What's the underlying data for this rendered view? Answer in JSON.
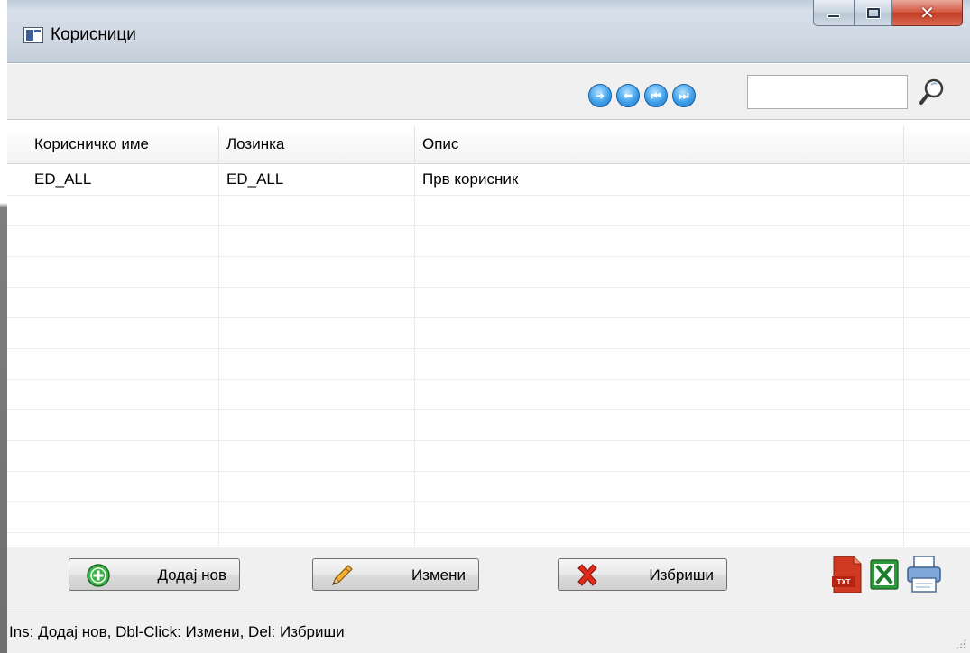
{
  "window": {
    "title": "Корисници"
  },
  "toolbar": {
    "nav_buttons": [
      {
        "icon": "arrow-right-icon",
        "glyph": "➜"
      },
      {
        "icon": "arrow-left-icon",
        "glyph": "⬅"
      },
      {
        "icon": "first-icon",
        "glyph": "⏮"
      },
      {
        "icon": "last-icon",
        "glyph": "⏭"
      }
    ],
    "search_value": ""
  },
  "grid": {
    "columns": [
      "Корисничко име",
      "Лозинка",
      "Опис"
    ],
    "rows": [
      [
        "ED_ALL",
        "ED_ALL",
        "Прв корисник"
      ]
    ]
  },
  "actions": {
    "add_label": "Додај нов",
    "edit_label": "Измени",
    "delete_label": "Избриши"
  },
  "export": {
    "txt_label": "TXT"
  },
  "status": {
    "text": "Ins: Додај нов, Dbl-Click: Измени, Del: Избриши"
  }
}
